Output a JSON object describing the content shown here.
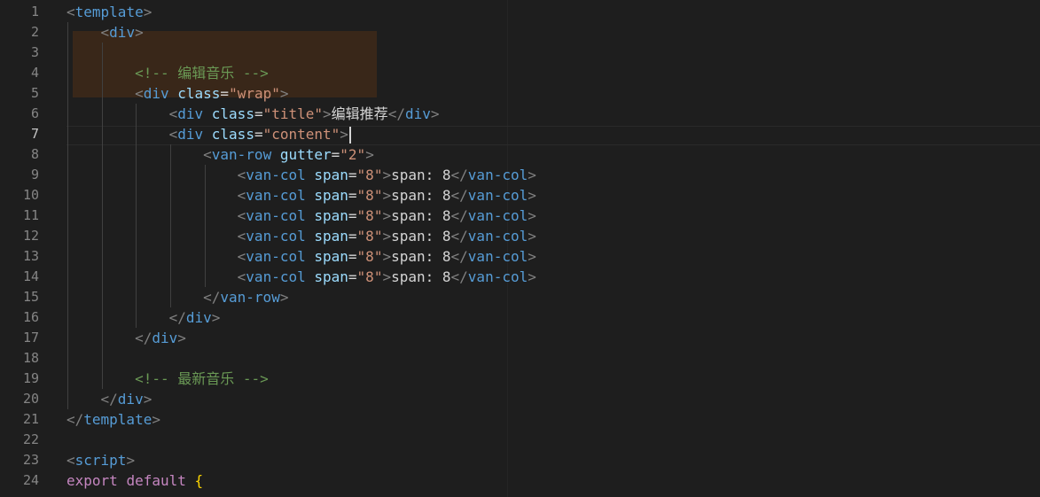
{
  "editor": {
    "line_numbers": [
      "1",
      "2",
      "3",
      "4",
      "5",
      "6",
      "7",
      "8",
      "9",
      "10",
      "11",
      "12",
      "13",
      "14",
      "15",
      "16",
      "17",
      "18",
      "19",
      "20",
      "21",
      "22",
      "23",
      "24"
    ],
    "lines": [
      [
        {
          "c": "punct",
          "t": "<"
        },
        {
          "c": "tag",
          "t": "template"
        },
        {
          "c": "punct",
          "t": ">"
        }
      ],
      [
        {
          "c": "txt",
          "t": "    "
        },
        {
          "c": "punct",
          "t": "<"
        },
        {
          "c": "tag",
          "t": "div"
        },
        {
          "c": "punct",
          "t": ">"
        }
      ],
      [],
      [
        {
          "c": "txt",
          "t": "        "
        },
        {
          "c": "cmt",
          "t": "<!-- 编辑音乐 -->"
        }
      ],
      [
        {
          "c": "txt",
          "t": "        "
        },
        {
          "c": "punct",
          "t": "<"
        },
        {
          "c": "tag",
          "t": "div"
        },
        {
          "c": "txt",
          "t": " "
        },
        {
          "c": "attr",
          "t": "class"
        },
        {
          "c": "txt",
          "t": "="
        },
        {
          "c": "str",
          "t": "\"wrap\""
        },
        {
          "c": "punct",
          "t": ">"
        }
      ],
      [
        {
          "c": "txt",
          "t": "            "
        },
        {
          "c": "punct",
          "t": "<"
        },
        {
          "c": "tag",
          "t": "div"
        },
        {
          "c": "txt",
          "t": " "
        },
        {
          "c": "attr",
          "t": "class"
        },
        {
          "c": "txt",
          "t": "="
        },
        {
          "c": "str",
          "t": "\"title\""
        },
        {
          "c": "punct",
          "t": ">"
        },
        {
          "c": "txt",
          "t": "编辑推荐"
        },
        {
          "c": "punct",
          "t": "</"
        },
        {
          "c": "tag",
          "t": "div"
        },
        {
          "c": "punct",
          "t": ">"
        }
      ],
      [
        {
          "c": "txt",
          "t": "            "
        },
        {
          "c": "punct",
          "t": "<"
        },
        {
          "c": "tag",
          "t": "div"
        },
        {
          "c": "txt",
          "t": " "
        },
        {
          "c": "attr",
          "t": "class"
        },
        {
          "c": "txt",
          "t": "="
        },
        {
          "c": "str",
          "t": "\"content\""
        },
        {
          "c": "punct",
          "t": ">"
        },
        {
          "c": "caret",
          "t": ""
        }
      ],
      [
        {
          "c": "txt",
          "t": "                "
        },
        {
          "c": "punct",
          "t": "<"
        },
        {
          "c": "tag",
          "t": "van-row"
        },
        {
          "c": "txt",
          "t": " "
        },
        {
          "c": "attr",
          "t": "gutter"
        },
        {
          "c": "txt",
          "t": "="
        },
        {
          "c": "str",
          "t": "\"2\""
        },
        {
          "c": "punct",
          "t": ">"
        }
      ],
      [
        {
          "c": "txt",
          "t": "                    "
        },
        {
          "c": "punct",
          "t": "<"
        },
        {
          "c": "tag",
          "t": "van-col"
        },
        {
          "c": "txt",
          "t": " "
        },
        {
          "c": "attr",
          "t": "span"
        },
        {
          "c": "txt",
          "t": "="
        },
        {
          "c": "str",
          "t": "\"8\""
        },
        {
          "c": "punct",
          "t": ">"
        },
        {
          "c": "txt",
          "t": "span: 8"
        },
        {
          "c": "punct",
          "t": "</"
        },
        {
          "c": "tag",
          "t": "van-col"
        },
        {
          "c": "punct",
          "t": ">"
        }
      ],
      [
        {
          "c": "txt",
          "t": "                    "
        },
        {
          "c": "punct",
          "t": "<"
        },
        {
          "c": "tag",
          "t": "van-col"
        },
        {
          "c": "txt",
          "t": " "
        },
        {
          "c": "attr",
          "t": "span"
        },
        {
          "c": "txt",
          "t": "="
        },
        {
          "c": "str",
          "t": "\"8\""
        },
        {
          "c": "punct",
          "t": ">"
        },
        {
          "c": "txt",
          "t": "span: 8"
        },
        {
          "c": "punct",
          "t": "</"
        },
        {
          "c": "tag",
          "t": "van-col"
        },
        {
          "c": "punct",
          "t": ">"
        }
      ],
      [
        {
          "c": "txt",
          "t": "                    "
        },
        {
          "c": "punct",
          "t": "<"
        },
        {
          "c": "tag",
          "t": "van-col"
        },
        {
          "c": "txt",
          "t": " "
        },
        {
          "c": "attr",
          "t": "span"
        },
        {
          "c": "txt",
          "t": "="
        },
        {
          "c": "str",
          "t": "\"8\""
        },
        {
          "c": "punct",
          "t": ">"
        },
        {
          "c": "txt",
          "t": "span: 8"
        },
        {
          "c": "punct",
          "t": "</"
        },
        {
          "c": "tag",
          "t": "van-col"
        },
        {
          "c": "punct",
          "t": ">"
        }
      ],
      [
        {
          "c": "txt",
          "t": "                    "
        },
        {
          "c": "punct",
          "t": "<"
        },
        {
          "c": "tag",
          "t": "van-col"
        },
        {
          "c": "txt",
          "t": " "
        },
        {
          "c": "attr",
          "t": "span"
        },
        {
          "c": "txt",
          "t": "="
        },
        {
          "c": "str",
          "t": "\"8\""
        },
        {
          "c": "punct",
          "t": ">"
        },
        {
          "c": "txt",
          "t": "span: 8"
        },
        {
          "c": "punct",
          "t": "</"
        },
        {
          "c": "tag",
          "t": "van-col"
        },
        {
          "c": "punct",
          "t": ">"
        }
      ],
      [
        {
          "c": "txt",
          "t": "                    "
        },
        {
          "c": "punct",
          "t": "<"
        },
        {
          "c": "tag",
          "t": "van-col"
        },
        {
          "c": "txt",
          "t": " "
        },
        {
          "c": "attr",
          "t": "span"
        },
        {
          "c": "txt",
          "t": "="
        },
        {
          "c": "str",
          "t": "\"8\""
        },
        {
          "c": "punct",
          "t": ">"
        },
        {
          "c": "txt",
          "t": "span: 8"
        },
        {
          "c": "punct",
          "t": "</"
        },
        {
          "c": "tag",
          "t": "van-col"
        },
        {
          "c": "punct",
          "t": ">"
        }
      ],
      [
        {
          "c": "txt",
          "t": "                    "
        },
        {
          "c": "punct",
          "t": "<"
        },
        {
          "c": "tag",
          "t": "van-col"
        },
        {
          "c": "txt",
          "t": " "
        },
        {
          "c": "attr",
          "t": "span"
        },
        {
          "c": "txt",
          "t": "="
        },
        {
          "c": "str",
          "t": "\"8\""
        },
        {
          "c": "punct",
          "t": ">"
        },
        {
          "c": "txt",
          "t": "span: 8"
        },
        {
          "c": "punct",
          "t": "</"
        },
        {
          "c": "tag",
          "t": "van-col"
        },
        {
          "c": "punct",
          "t": ">"
        }
      ],
      [
        {
          "c": "txt",
          "t": "                "
        },
        {
          "c": "punct",
          "t": "</"
        },
        {
          "c": "tag",
          "t": "van-row"
        },
        {
          "c": "punct",
          "t": ">"
        }
      ],
      [
        {
          "c": "txt",
          "t": "            "
        },
        {
          "c": "punct",
          "t": "</"
        },
        {
          "c": "tag",
          "t": "div"
        },
        {
          "c": "punct",
          "t": ">"
        }
      ],
      [
        {
          "c": "txt",
          "t": "        "
        },
        {
          "c": "punct",
          "t": "</"
        },
        {
          "c": "tag",
          "t": "div"
        },
        {
          "c": "punct",
          "t": ">"
        }
      ],
      [],
      [
        {
          "c": "txt",
          "t": "        "
        },
        {
          "c": "cmt",
          "t": "<!-- 最新音乐 -->"
        }
      ],
      [
        {
          "c": "txt",
          "t": "    "
        },
        {
          "c": "punct",
          "t": "</"
        },
        {
          "c": "tag",
          "t": "div"
        },
        {
          "c": "punct",
          "t": ">"
        }
      ],
      [
        {
          "c": "punct",
          "t": "</"
        },
        {
          "c": "tag",
          "t": "template"
        },
        {
          "c": "punct",
          "t": ">"
        }
      ],
      [],
      [
        {
          "c": "punct",
          "t": "<"
        },
        {
          "c": "tag",
          "t": "script"
        },
        {
          "c": "punct",
          "t": ">"
        }
      ],
      [
        {
          "c": "kw",
          "t": "export"
        },
        {
          "c": "txt",
          "t": " "
        },
        {
          "c": "kw",
          "t": "default"
        },
        {
          "c": "txt",
          "t": " "
        },
        {
          "c": "brace",
          "t": "{"
        }
      ]
    ],
    "active_line": 7
  },
  "colors": {
    "background": "#1e1e1e",
    "tag": "#569cd6",
    "attribute": "#9cdcfe",
    "string": "#ce9178",
    "comment": "#6a9955",
    "keyword": "#c586c0"
  }
}
